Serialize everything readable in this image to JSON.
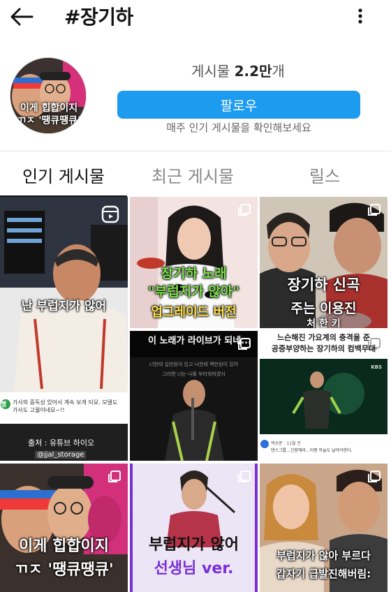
{
  "header": {
    "title": "#장기하"
  },
  "profile": {
    "avatar_caption_line1": "이게 힙합이지",
    "avatar_caption_line2": "ㄲㅈ '땡큐땡큐'",
    "posts_label": "게시물",
    "posts_count": "2.2만",
    "posts_suffix": "개",
    "follow_label": "팔로우",
    "hint": "매주 인기 게시물을 확인해보세요"
  },
  "tabs": [
    {
      "label": "인기 게시물",
      "active": true
    },
    {
      "label": "최근 게시물",
      "active": false
    },
    {
      "label": "릴스",
      "active": false
    }
  ],
  "grid": {
    "c1": {
      "caption": "난 부럽지가 않어",
      "comment_badge": "행",
      "comment_text": "가사의 중독성 있어서 계속 보게 되요. 모델도 가사도 고퀄이네요~!!",
      "source": "출처 : 유튜브 하이오",
      "watermark": "@jjal_storage"
    },
    "c2": {
      "line1": "장기하 노래",
      "line2": "\"부럽지가 않아\"",
      "line3": "업그레이드 버전"
    },
    "c3": {
      "line1": "장기하 신곡",
      "line2": "주는 이용진",
      "line3": "처 한 키"
    },
    "c4": {
      "banner": "이 노래가 라이브가 되네...",
      "lyric1": "너한테 십만원이 있고 나한테 백만원이 있어",
      "lyric2": "그러면 너는 나를 부러워하겠지"
    },
    "c5": {
      "line1": "느슨해진 가요계의 충격을 준",
      "line2": "공중부양하는 장기하의 컴백무대",
      "broadcaster": "KBS",
      "comment": "댄스그룹...긴장해라...이젠 하늘도 날아야한다.",
      "username": "백승준 · 11월 전"
    },
    "c6": {
      "line1": "이게 힙합이지",
      "line2": "ㄲㅈ '땡큐땡큐'"
    },
    "c7": {
      "line1": "부럽지가 않어",
      "line2": "선생님 ver."
    },
    "c8": {
      "line1": "부럽지가 않아 부르다",
      "line2": "갑자기 급발진해버림:"
    }
  },
  "colors": {
    "follow_button": "#1c9bef",
    "accent_yellow": "#ffe14a",
    "accent_green": "#7ee04a",
    "accent_purple": "#7b2fd6"
  }
}
